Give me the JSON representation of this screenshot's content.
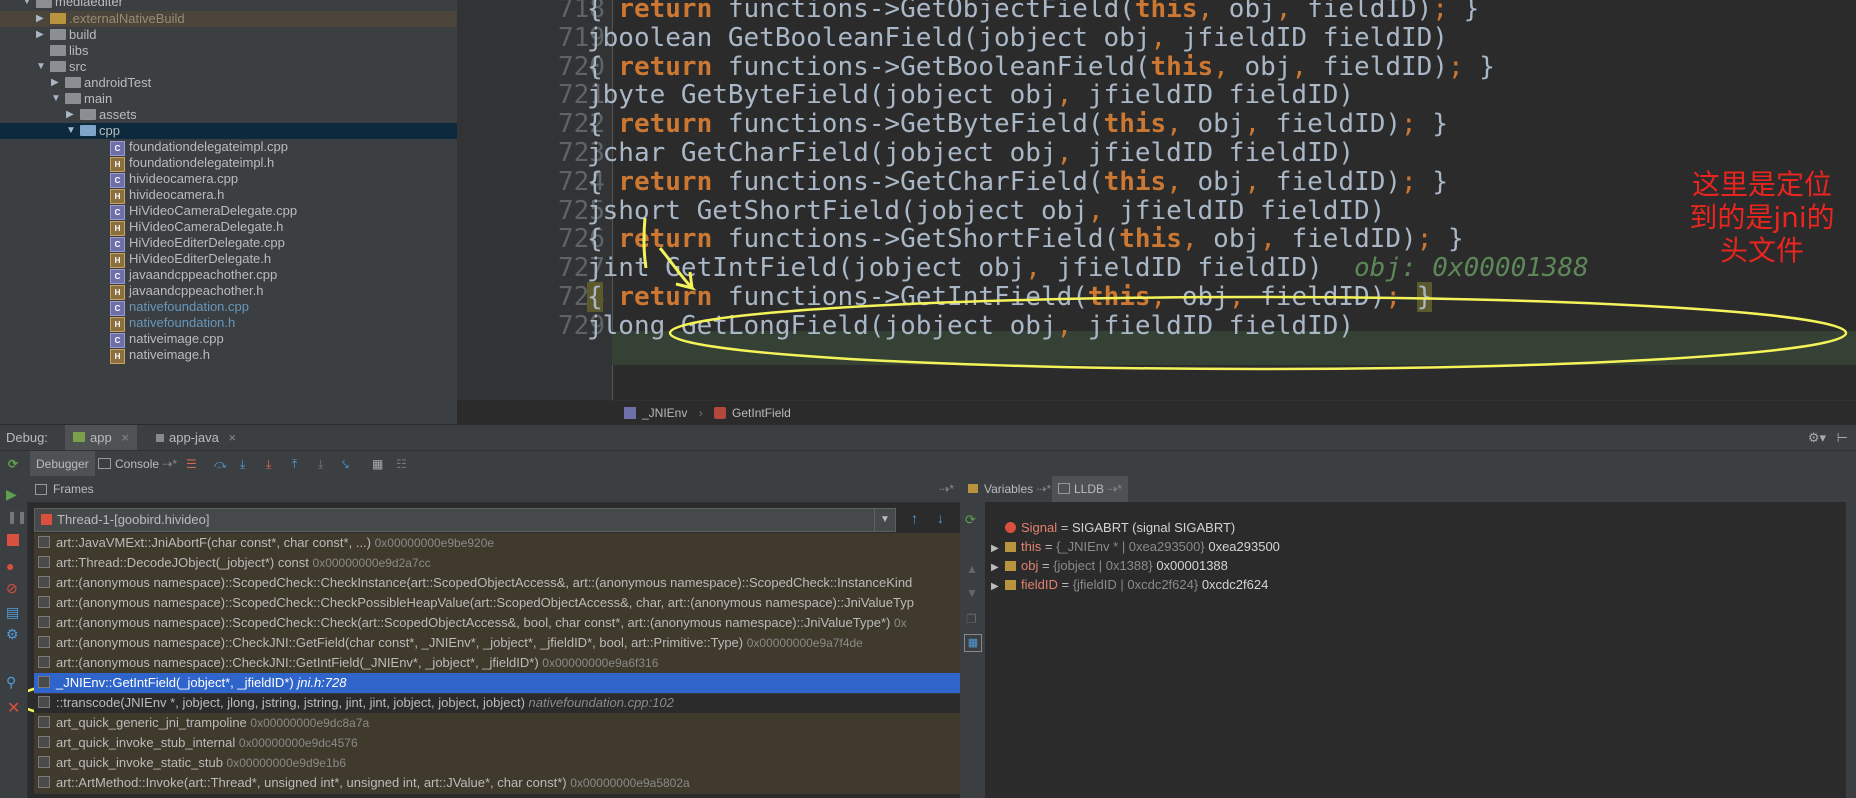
{
  "tree": {
    "root": "mediaediter",
    "items": [
      {
        "label": ".externalNativeBuild",
        "indent": 1,
        "arrow": "▶",
        "icon": "folder-orange",
        "style": "hl"
      },
      {
        "label": "build",
        "indent": 1,
        "arrow": "▶",
        "icon": "folder",
        "style": ""
      },
      {
        "label": "libs",
        "indent": 1,
        "arrow": "",
        "icon": "folder",
        "style": ""
      },
      {
        "label": "src",
        "indent": 1,
        "arrow": "▼",
        "icon": "folder",
        "style": ""
      },
      {
        "label": "androidTest",
        "indent": 2,
        "arrow": "▶",
        "icon": "folder",
        "style": ""
      },
      {
        "label": "main",
        "indent": 2,
        "arrow": "▼",
        "icon": "folder",
        "style": ""
      },
      {
        "label": "assets",
        "indent": 3,
        "arrow": "▶",
        "icon": "folder",
        "style": ""
      },
      {
        "label": "cpp",
        "indent": 3,
        "arrow": "▼",
        "icon": "folder-blue",
        "style": "sel"
      },
      {
        "label": "foundationdelegateimpl.cpp",
        "indent": 5,
        "arrow": "",
        "icon": "cpp",
        "style": ""
      },
      {
        "label": "foundationdelegateimpl.h",
        "indent": 5,
        "arrow": "",
        "icon": "h",
        "style": ""
      },
      {
        "label": "hivideocamera.cpp",
        "indent": 5,
        "arrow": "",
        "icon": "cpp",
        "style": ""
      },
      {
        "label": "hivideocamera.h",
        "indent": 5,
        "arrow": "",
        "icon": "h",
        "style": ""
      },
      {
        "label": "HiVideoCameraDelegate.cpp",
        "indent": 5,
        "arrow": "",
        "icon": "cpp",
        "style": ""
      },
      {
        "label": "HiVideoCameraDelegate.h",
        "indent": 5,
        "arrow": "",
        "icon": "h",
        "style": ""
      },
      {
        "label": "HiVideoEditerDelegate.cpp",
        "indent": 5,
        "arrow": "",
        "icon": "cpp",
        "style": ""
      },
      {
        "label": "HiVideoEditerDelegate.h",
        "indent": 5,
        "arrow": "",
        "icon": "h",
        "style": ""
      },
      {
        "label": "javaandcppeachother.cpp",
        "indent": 5,
        "arrow": "",
        "icon": "cpp",
        "style": ""
      },
      {
        "label": "javaandcppeachother.h",
        "indent": 5,
        "arrow": "",
        "icon": "h",
        "style": ""
      },
      {
        "label": "nativefoundation.cpp",
        "indent": 5,
        "arrow": "",
        "icon": "cpp",
        "style": "blue"
      },
      {
        "label": "nativefoundation.h",
        "indent": 5,
        "arrow": "",
        "icon": "h",
        "style": "blue"
      },
      {
        "label": "nativeimage.cpp",
        "indent": 5,
        "arrow": "",
        "icon": "cpp",
        "style": ""
      },
      {
        "label": "nativeimage.h",
        "indent": 5,
        "arrow": "",
        "icon": "h",
        "style": ""
      }
    ]
  },
  "editor": {
    "lines": [
      {
        "num": "718",
        "html": "{ <span class='kw'>return</span> functions->GetObjectField(<span class='kw'>this</span><span class='pun'>,</span> obj<span class='pun'>,</span> fieldID)<span class='pun'>;</span> }"
      },
      {
        "num": "719",
        "html": "jboolean GetBooleanField(jobject obj<span class='pun'>,</span> jfieldID fieldID)"
      },
      {
        "num": "720",
        "html": "{ <span class='kw'>return</span> functions->GetBooleanField(<span class='kw'>this</span><span class='pun'>,</span> obj<span class='pun'>,</span> fieldID)<span class='pun'>;</span> }"
      },
      {
        "num": "721",
        "html": "jbyte GetByteField(jobject obj<span class='pun'>,</span> jfieldID fieldID)"
      },
      {
        "num": "722",
        "html": "{ <span class='kw'>return</span> functions->GetByteField(<span class='kw'>this</span><span class='pun'>,</span> obj<span class='pun'>,</span> fieldID)<span class='pun'>;</span> }"
      },
      {
        "num": "723",
        "html": "jchar GetCharField(jobject obj<span class='pun'>,</span> jfieldID fieldID)"
      },
      {
        "num": "724",
        "html": "{ <span class='kw'>return</span> functions->GetCharField(<span class='kw'>this</span><span class='pun'>,</span> obj<span class='pun'>,</span> fieldID)<span class='pun'>;</span> }"
      },
      {
        "num": "725",
        "html": "jshort GetShortField(jobject obj<span class='pun'>,</span> jfieldID fieldID)"
      },
      {
        "num": "726",
        "html": "{ <span class='kw'>return</span> functions->GetShortField(<span class='kw'>this</span><span class='pun'>,</span> obj<span class='pun'>,</span> fieldID)<span class='pun'>;</span> }"
      },
      {
        "num": "727",
        "html": "jint GetIntField(jobject obj<span class='pun'>,</span> jfieldID fieldID)  <span class='hint'>obj: 0x00001388</span>"
      },
      {
        "num": "728",
        "html": "<span style='background:#5c5a2c'>{</span> <span class='kw'>return</span> functions->GetIntField(<span class='kw'>this</span><span class='pun'>,</span> obj<span class='pun'>,</span> fieldID)<span class='pun'>;</span> <span style='background:#5c5a2c'>}</span>"
      },
      {
        "num": "729",
        "html": "jlong GetLongField(jobject obj<span class='pun'>,</span> jfieldID fieldID)"
      }
    ],
    "annotation": "这里是定位\n到的是jni的\n头文件"
  },
  "breadcrumb": {
    "class_name": "_JNIEnv",
    "method_name": "GetIntField"
  },
  "debug": {
    "label": "Debug:",
    "tab_app": "app",
    "tab_app_java": "app-java",
    "debugger_tab": "Debugger",
    "console_tab": "Console",
    "frames_title": "Frames",
    "variables_tab": "Variables",
    "lldb_tab": "LLDB",
    "thread": "Thread-1-[goobird.hivideo]"
  },
  "frames": [
    {
      "text": "art::JavaVMExt::JniAbortF(char const*, char const*, ...)",
      "addr": "0x00000000e9be920e",
      "loc": "",
      "style": "dim"
    },
    {
      "text": "art::Thread::DecodeJObject(_jobject*) const",
      "addr": "0x00000000e9d2a7cc",
      "loc": "",
      "style": "dim"
    },
    {
      "text": "art::(anonymous namespace)::ScopedCheck::CheckInstance(art::ScopedObjectAccess&, art::(anonymous namespace)::ScopedCheck::InstanceKind",
      "addr": "",
      "loc": "",
      "style": "dim"
    },
    {
      "text": "art::(anonymous namespace)::ScopedCheck::CheckPossibleHeapValue(art::ScopedObjectAccess&, char, art::(anonymous namespace)::JniValueTyp",
      "addr": "",
      "loc": "",
      "style": "dim"
    },
    {
      "text": "art::(anonymous namespace)::ScopedCheck::Check(art::ScopedObjectAccess&, bool, char const*, art::(anonymous namespace)::JniValueType*)",
      "addr": "0x",
      "loc": "",
      "style": "dim"
    },
    {
      "text": "art::(anonymous namespace)::CheckJNI::GetField(char const*, _JNIEnv*, _jobject*, _jfieldID*, bool, art::Primitive::Type)",
      "addr": "0x00000000e9a7f4de",
      "loc": "",
      "style": "dim"
    },
    {
      "text": "art::(anonymous namespace)::CheckJNI::GetIntField(_JNIEnv*, _jobject*, _jfieldID*)",
      "addr": "0x00000000e9a6f316",
      "loc": "",
      "style": "dim"
    },
    {
      "text": "_JNIEnv::GetIntField(_jobject*, _jfieldID*)",
      "addr": "",
      "loc": "jni.h:728",
      "style": "sel"
    },
    {
      "text": "::transcode(JNIEnv *, jobject, jlong, jstring, jstring, jint, jint, jobject, jobject, jobject)",
      "addr": "",
      "loc": "nativefoundation.cpp:102",
      "style": ""
    },
    {
      "text": "art_quick_generic_jni_trampoline",
      "addr": "0x00000000e9dc8a7a",
      "loc": "",
      "style": "dim"
    },
    {
      "text": "art_quick_invoke_stub_internal",
      "addr": "0x00000000e9dc4576",
      "loc": "",
      "style": "dim"
    },
    {
      "text": "art_quick_invoke_static_stub",
      "addr": "0x00000000e9d9e1b6",
      "loc": "",
      "style": "dim"
    },
    {
      "text": "art::ArtMethod::Invoke(art::Thread*, unsigned int*, unsigned int, art::JValue*, char const*)",
      "addr": "0x00000000e9a5802a",
      "loc": "",
      "style": "dim"
    }
  ],
  "variables": [
    {
      "arrow": "",
      "icon": "signal",
      "name": "Signal",
      "eq": " = ",
      "type": "",
      "value": "SIGABRT (signal SIGABRT)"
    },
    {
      "arrow": "▶",
      "icon": "field",
      "name": "this",
      "eq": " = ",
      "type": "{_JNIEnv * | 0xea293500} ",
      "value": "0xea293500"
    },
    {
      "arrow": "▶",
      "icon": "field",
      "name": "obj",
      "eq": " = ",
      "type": "{jobject | 0x1388} ",
      "value": "0x00001388"
    },
    {
      "arrow": "▶",
      "icon": "field",
      "name": "fieldID",
      "eq": " = ",
      "type": "{jfieldID | 0xcdc2f624} ",
      "value": "0xcdc2f624"
    }
  ]
}
